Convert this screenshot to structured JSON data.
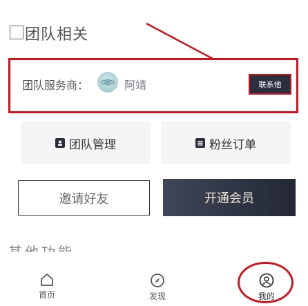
{
  "section": {
    "title": "团队相关"
  },
  "team_service": {
    "label": "团队服务商：",
    "staff_name": "阿靖",
    "contact_label": "联系他"
  },
  "actions": {
    "team_manage": "团队管理",
    "fans_orders": "粉丝订单"
  },
  "buttons": {
    "invite": "邀请好友",
    "open_vip": "开通会员"
  },
  "partial_text": "其他功能",
  "tabbar": {
    "home": "首页",
    "discover": "发现",
    "mine": "我的"
  },
  "colors": {
    "annotation_red": "#d0141e",
    "dark_navy": "#2a2e3d",
    "vip_text": "#f2e9d8"
  }
}
